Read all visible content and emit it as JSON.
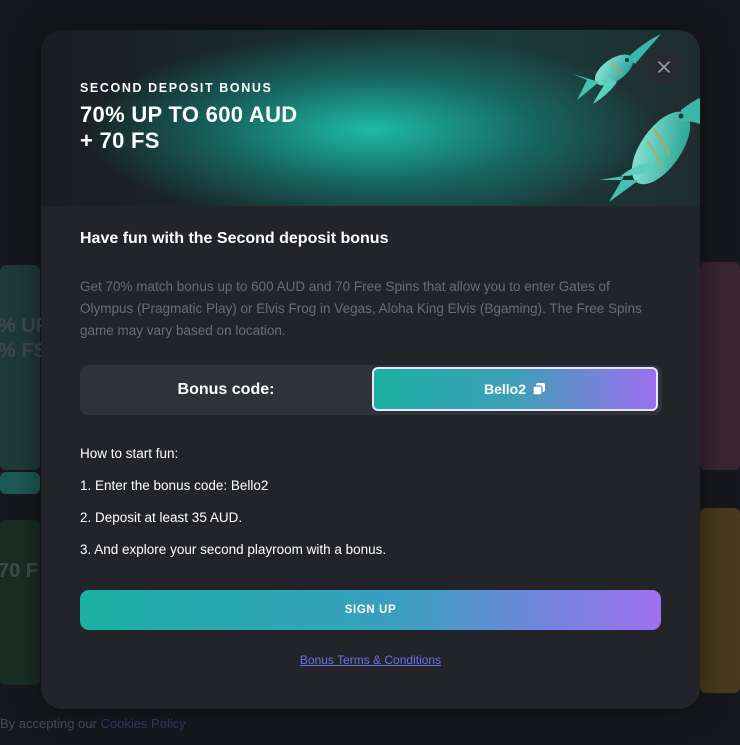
{
  "background": {
    "left_text_1": "% UP",
    "left_text_2": "% FS",
    "left_text_3": "70 F",
    "footer_text": "By accepting our",
    "footer_link": "Cookies Policy"
  },
  "modal": {
    "eyebrow": "SECOND DEPOSIT BONUS",
    "title": "70% UP TO 600 AUD\n+ 70 FS",
    "close_icon": "close-icon",
    "heading": "Have fun with the Second deposit bonus",
    "description": "Get 70% match bonus up to 600 AUD and 70 Free Spins that allow you to enter Gates of Olympus (Pragmatic Play) or Elvis Frog in Vegas, Aloha King Elvis (Bgaming). The Free Spins game may vary based on location.",
    "bonus_code_label": "Bonus code:",
    "bonus_code_value": "Bello2",
    "copy_icon": "copy-icon",
    "steps_title": "How to start fun:",
    "steps": [
      "1. Enter the bonus code: Bello2",
      "2. Deposit at least 35 AUD.",
      "3. And explore your second playroom with a bonus."
    ],
    "signup_label": "SIGN UP",
    "terms_link": "Bonus Terms & Conditions"
  },
  "colors": {
    "accent_teal": "#1bb0a3",
    "accent_purple": "#a070f2",
    "link": "#6a72e8",
    "modal_bg": "#23242a"
  }
}
